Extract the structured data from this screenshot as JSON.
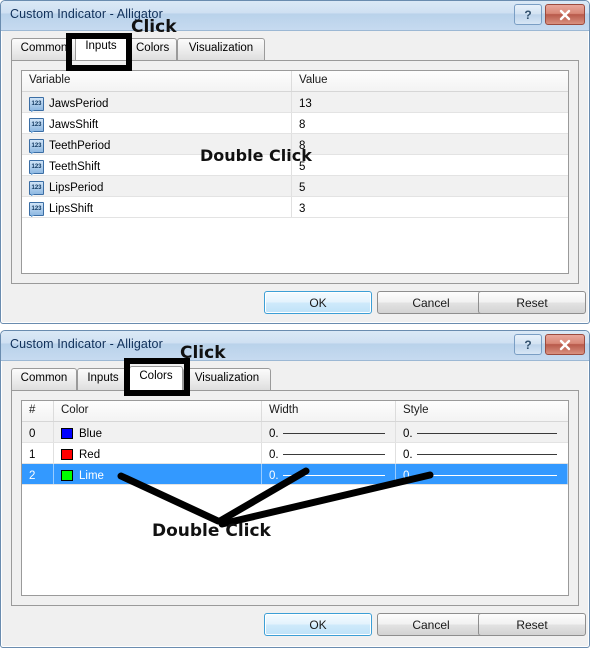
{
  "window": {
    "title": "Custom Indicator - Alligator",
    "help_button": "?",
    "close_button": "x"
  },
  "tabs": {
    "items": [
      "Common",
      "Inputs",
      "Colors",
      "Visualization"
    ],
    "active_dialog1": "Inputs",
    "active_dialog2": "Colors"
  },
  "inputs_tab": {
    "columns": [
      "Variable",
      "Value"
    ],
    "rows": [
      {
        "icon": "variable-123-icon",
        "variable": "JawsPeriod",
        "value": "13"
      },
      {
        "icon": "variable-123-icon",
        "variable": "JawsShift",
        "value": "8"
      },
      {
        "icon": "variable-123-icon",
        "variable": "TeethPeriod",
        "value": "8"
      },
      {
        "icon": "variable-123-icon",
        "variable": "TeethShift",
        "value": "5"
      },
      {
        "icon": "variable-123-icon",
        "variable": "LipsPeriod",
        "value": "5"
      },
      {
        "icon": "variable-123-icon",
        "variable": "LipsShift",
        "value": "3"
      }
    ]
  },
  "colors_tab": {
    "columns": [
      "#",
      "Color",
      "Width",
      "Style"
    ],
    "rows": [
      {
        "index": "0",
        "color_name": "Blue",
        "color_hex": "#0000FF",
        "width": "0.",
        "style": "0.",
        "selected": false
      },
      {
        "index": "1",
        "color_name": "Red",
        "color_hex": "#FF0000",
        "width": "0.",
        "style": "0.",
        "selected": false
      },
      {
        "index": "2",
        "color_name": "Lime",
        "color_hex": "#00FF00",
        "width": "0.",
        "style": "0.",
        "selected": true
      }
    ]
  },
  "footer": {
    "ok": "OK",
    "cancel": "Cancel",
    "reset": "Reset"
  },
  "annotations": {
    "click_top": "Click",
    "double_click_inputs": "Double Click",
    "click_colors": "Click",
    "double_click_colors": "Double Click"
  },
  "colors": {
    "selection_blue": "#3399ff",
    "titlebar_blue": "#b9d2ea",
    "close_red": "#b8594a",
    "annotation_black": "#000000"
  },
  "icon_names": {
    "help": "help-icon",
    "close": "close-icon",
    "variable": "variable-123-icon",
    "swatch": "color-swatch-icon",
    "line_preview": "line-style-preview-icon"
  }
}
